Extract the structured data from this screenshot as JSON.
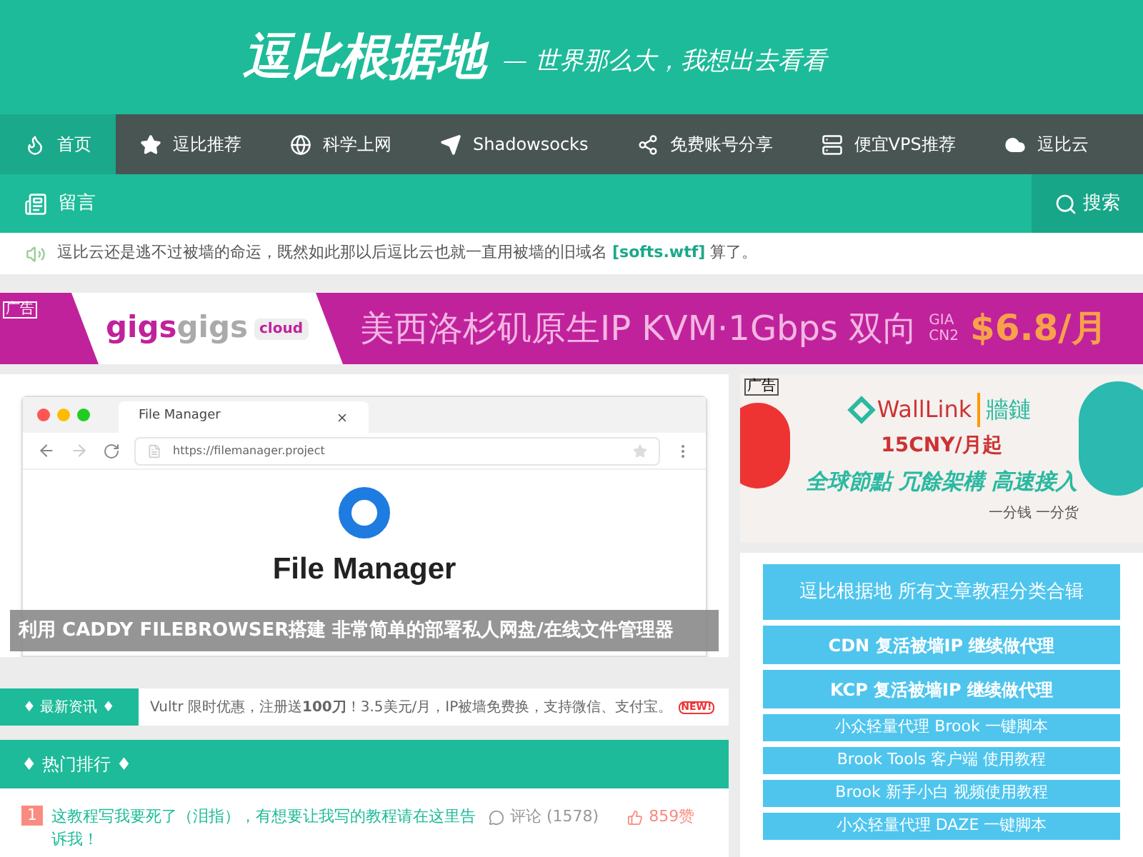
{
  "header": {
    "logo": "逗比根据地",
    "slogan": "— 世界那么大，我想出去看看"
  },
  "nav": [
    {
      "label": "首页",
      "selected": true
    },
    {
      "label": "逗比推荐",
      "selected": false
    },
    {
      "label": "科学上网",
      "selected": false
    },
    {
      "label": "Shadowsocks",
      "selected": false
    },
    {
      "label": "免费账号分享",
      "selected": false
    },
    {
      "label": "便宜VPS推荐",
      "selected": false
    },
    {
      "label": "逗比云",
      "selected": false
    }
  ],
  "subnav": {
    "items": [
      {
        "label": "留言"
      }
    ],
    "search": "搜索"
  },
  "notice": {
    "text": "逗比云还是逃不过被墙的命运，既然如此那以后逗比云也就一直用被墙的旧域名 ",
    "link": "[softs.wtf]",
    "tail": " 算了。"
  },
  "banner_ad": {
    "tag": "广告",
    "brand_a": "gigs",
    "brand_b": "gigs",
    "brand_sub": "cloud",
    "headline": "美西洛杉矶原生IP KVM·1Gbps 双向",
    "badge_top": "GIA",
    "badge_bottom": "CN2",
    "price": "$6.8/月"
  },
  "slider": {
    "tab": "File Manager",
    "url": "https://filemanager.project",
    "heading": "File Manager",
    "caption": "利用 CADDY FILEBROWSER搭建 非常简单的部署私人网盘/在线文件管理器"
  },
  "news": {
    "title": "♦ 最新资讯 ♦",
    "text": "Vultr 限时优惠，注册送**100刀**！3.5美元/月，IP被墙免费换，支持微信、支付宝。",
    "badge": "NEW!"
  },
  "hot": {
    "title": "♦ 热门排行 ♦",
    "items": [
      {
        "rank": "1",
        "title": "这教程写我要死了（泪指），有想要让我写的教程请在这里告诉我！",
        "comments": "评论 (1578)",
        "likes": "859赞"
      }
    ]
  },
  "side_ad": {
    "tag": "广告",
    "brand": "WallLink",
    "brand_cn": "牆鏈",
    "price": "15CNY/月起",
    "slogan": "全球節點 冗餘架構 高速接入",
    "motto": "一分钱 一分货"
  },
  "side_links": [
    {
      "label": "逗比根据地 所有文章教程分类合辑",
      "kind": "main"
    },
    {
      "label": "CDN 复活被墙IP 继续做代理",
      "kind": "bold"
    },
    {
      "label": "KCP 复活被墙IP 继续做代理",
      "kind": "bold"
    },
    {
      "label": "小众轻量代理 Brook 一键脚本",
      "kind": "plain"
    },
    {
      "label": "Brook Tools 客户端 使用教程",
      "kind": "plain"
    },
    {
      "label": "Brook 新手小白 视频使用教程",
      "kind": "plain"
    },
    {
      "label": "小众轻量代理 DAZE 一键脚本",
      "kind": "plain"
    }
  ]
}
